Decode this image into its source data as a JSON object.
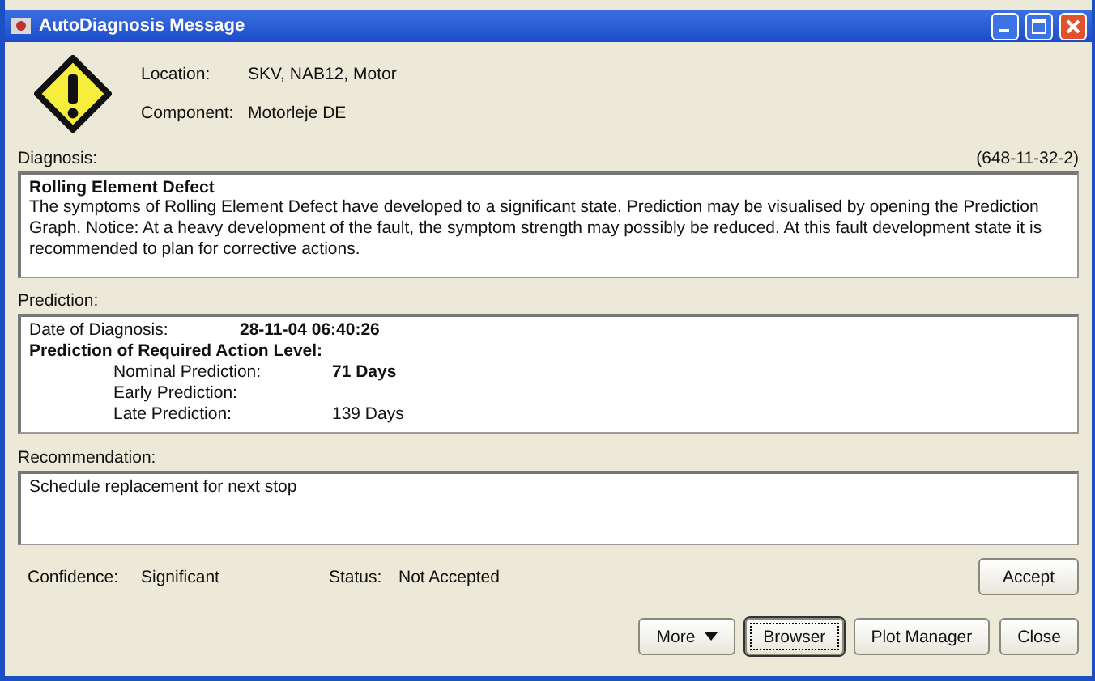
{
  "window": {
    "title": "AutoDiagnosis Message"
  },
  "header": {
    "fields": [
      {
        "label": "Location:",
        "value": "SKV, NAB12, Motor"
      },
      {
        "label": "Component:",
        "value": "Motorleje DE"
      }
    ]
  },
  "diagnosis": {
    "label": "Diagnosis:",
    "code": "(648-11-32-2)",
    "title": "Rolling Element Defect",
    "text": "The symptoms of Rolling Element Defect have developed to a significant state. Prediction may be visualised by opening the Prediction Graph. Notice: At a heavy development of the fault, the symptom strength may possibly be reduced. At this fault development state it is recommended to plan for corrective actions."
  },
  "prediction": {
    "label": "Prediction:",
    "date_label": "Date of Diagnosis:",
    "date_value": "28-11-04 06:40:26",
    "heading": "Prediction of Required Action Level:",
    "rows": [
      {
        "label": "Nominal Prediction:",
        "value": "71 Days",
        "bold": true
      },
      {
        "label": "Early Prediction:"
      },
      {
        "label": "Late Prediction:",
        "value": "139 Days",
        "bold": false
      }
    ]
  },
  "recommendation": {
    "label": "Recommendation:",
    "text": "Schedule replacement for next stop"
  },
  "status_row": {
    "confidence_label": "Confidence:",
    "confidence": "Significant",
    "status_label": "Status:",
    "status": "Not Accepted",
    "accept_button": "Accept"
  },
  "buttons": [
    {
      "label": "More",
      "kind": "dropdown",
      "focused": false
    },
    {
      "label": "Browser",
      "kind": "plain",
      "focused": true
    },
    {
      "label": "Plot Manager",
      "kind": "plain",
      "focused": false
    },
    {
      "label": "Close",
      "kind": "plain",
      "focused": false
    }
  ]
}
